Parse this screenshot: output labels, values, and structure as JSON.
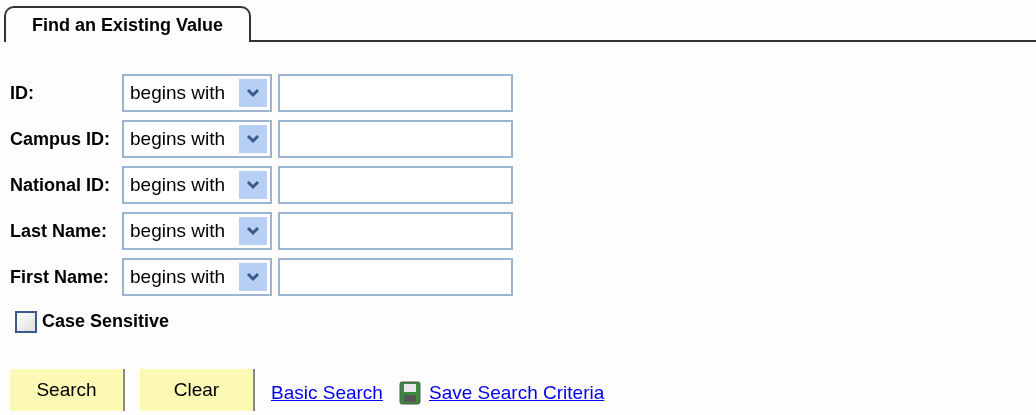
{
  "tab": {
    "label": "Find an Existing Value",
    "selected": true
  },
  "fields": [
    {
      "label": "ID:",
      "operator": "begins with"
    },
    {
      "label": "Campus ID:",
      "operator": "begins with"
    },
    {
      "label": "National ID:",
      "operator": "begins with"
    },
    {
      "label": "Last Name:",
      "operator": "begins with"
    },
    {
      "label": "First Name:",
      "operator": "begins with"
    }
  ],
  "case_sensitive": {
    "label": "Case Sensitive",
    "checked": false
  },
  "buttons": [
    "Search",
    "Clear"
  ],
  "links": [
    {
      "label": "Basic Search",
      "icon": false
    },
    {
      "label": "Save Search Criteria",
      "icon": true
    }
  ]
}
